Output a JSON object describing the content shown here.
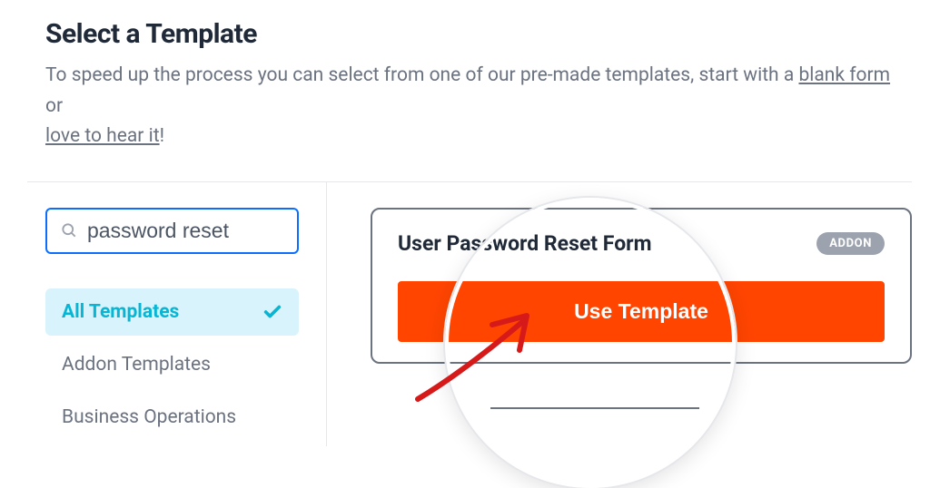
{
  "header": {
    "title": "Select a Template",
    "subtitle_before_link1": "To speed up the process you can select from one of our pre-made templates, start with a ",
    "link1": "blank form",
    "subtitle_after_link1": " or ",
    "link2": "love to hear it",
    "after_link2": "!"
  },
  "search": {
    "value": "password reset"
  },
  "categories": {
    "items": [
      {
        "label": "All Templates",
        "active": true
      },
      {
        "label": "Addon Templates",
        "active": false
      },
      {
        "label": "Business Operations",
        "active": false
      }
    ]
  },
  "template": {
    "name": "User Password Reset Form",
    "badge": "ADDON",
    "button": "Use Template"
  },
  "colors": {
    "accent_orange": "#ff4500",
    "accent_cyan": "#06b6d4",
    "accent_blue_border": "#0d6efd"
  }
}
